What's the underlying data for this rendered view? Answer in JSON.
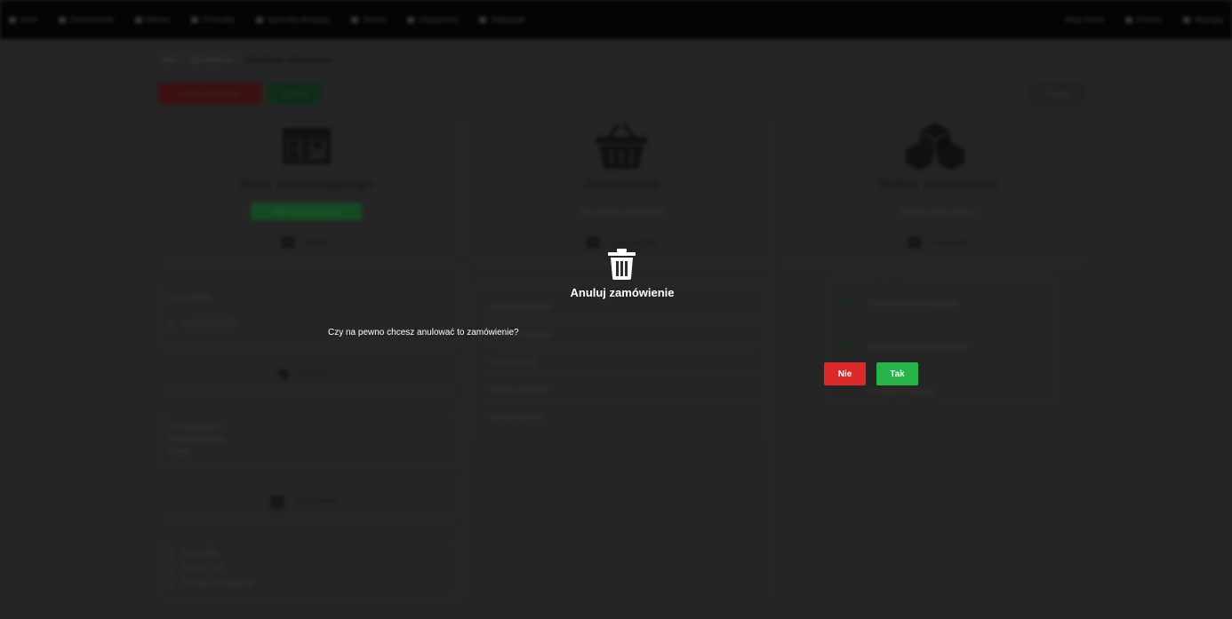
{
  "nav": {
    "left_items": [
      "Start",
      "Zamówienia",
      "Klienci",
      "Produkty",
      "Sposoby dostawy",
      "Strony",
      "Ustawienia",
      "Statystyki"
    ],
    "right_items": [
      "Moje konto",
      "Pomoc",
      "Wyloguj"
    ]
  },
  "breadcrumb": {
    "items": [
      "Start",
      "Zamówienia"
    ],
    "current": "Szczegóły zamówienia"
  },
  "toolbar": {
    "cancel_label": "Anuluj zamówienie",
    "done_label": "Zrealizuj",
    "back_label": "Powrót"
  },
  "columns": [
    {
      "title": "Dane zamawiającego",
      "badge": "Klient zarejestrowany",
      "subhead": "Klient",
      "fields": [
        "Jan Kowalski",
        "+48 123 456 789"
      ],
      "section2_title": "Adres",
      "address_lines": [
        "ul. Przykładowa 1",
        "00-001 Warszawa",
        "Polska"
      ],
      "section3_title": "Dostawa",
      "delivery_lines": [
        "Kurier DPD",
        "Paczka 1 szt.",
        "Płatność przy odbiorze"
      ]
    },
    {
      "title": "Zamówienie",
      "badge": "Data złożenia zamówienia",
      "subhead": "Szczegóły",
      "rows": [
        "Numer zamówienia",
        "Wartość produktów",
        "Koszt dostawy",
        "Wartość całkowita",
        "Sposób płatności"
      ]
    },
    {
      "title": "Status zamówienia",
      "badge": "Ostatnia zmiana statusu",
      "subhead": "Historia",
      "steps": [
        {
          "title": "Przyjęte",
          "desc": "Zamówienie zostało przyjęte"
        },
        {
          "title": "W przygotowaniu",
          "desc": "Zamówienie jest kompletowane"
        },
        {
          "title": "",
          "desc": "Oczekuje na wysyłkę"
        }
      ]
    }
  ],
  "modal": {
    "icon": "trash-icon",
    "title": "Anuluj zamówienie",
    "message": "Czy na pewno chcesz anulować to zamówienie?",
    "no_label": "Nie",
    "yes_label": "Tak",
    "no_color": "#dc2a2a",
    "yes_color": "#26b34a"
  }
}
